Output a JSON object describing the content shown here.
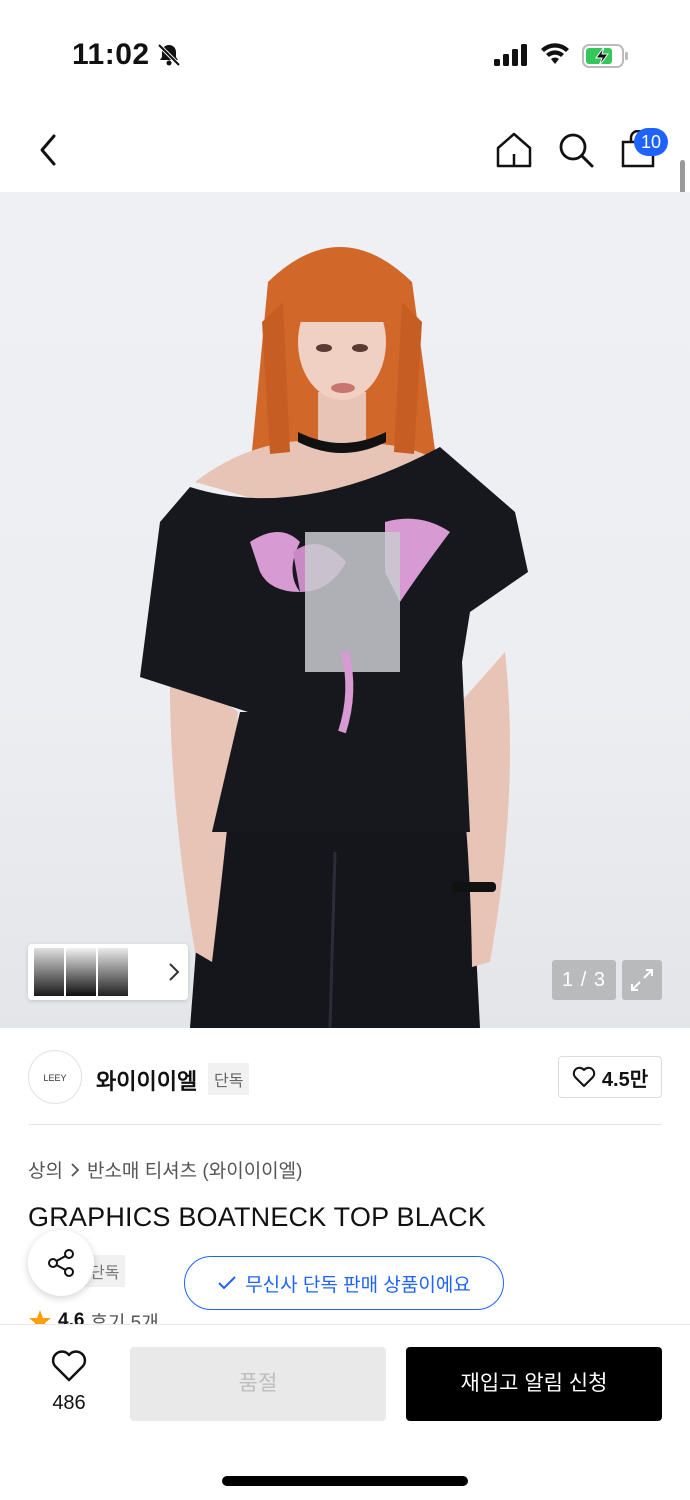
{
  "status_bar": {
    "time": "11:02"
  },
  "nav": {
    "cart_count": "10"
  },
  "hero": {
    "counter": "1 / 3"
  },
  "brand": {
    "logo_text": "LEEY",
    "name": "와이이이엘",
    "exclusive_label": "단독",
    "likes": "4.5만"
  },
  "breadcrumb": {
    "category": "상의",
    "subcategory": "반소매 티셔츠 (와이이이엘)"
  },
  "product": {
    "title": "GRAPHICS BOATNECK TOP BLACK",
    "tag": "단독"
  },
  "notice": {
    "text": "무신사 단독 판매 상품이에요"
  },
  "rating": {
    "score": "4.6",
    "reviews": "후기 5개"
  },
  "bottom_bar": {
    "wish_count": "486",
    "soldout_label": "품절",
    "restock_label": "재입고 알림 신청"
  },
  "colors": {
    "accent": "#1e63ff",
    "battery": "#34c759"
  }
}
